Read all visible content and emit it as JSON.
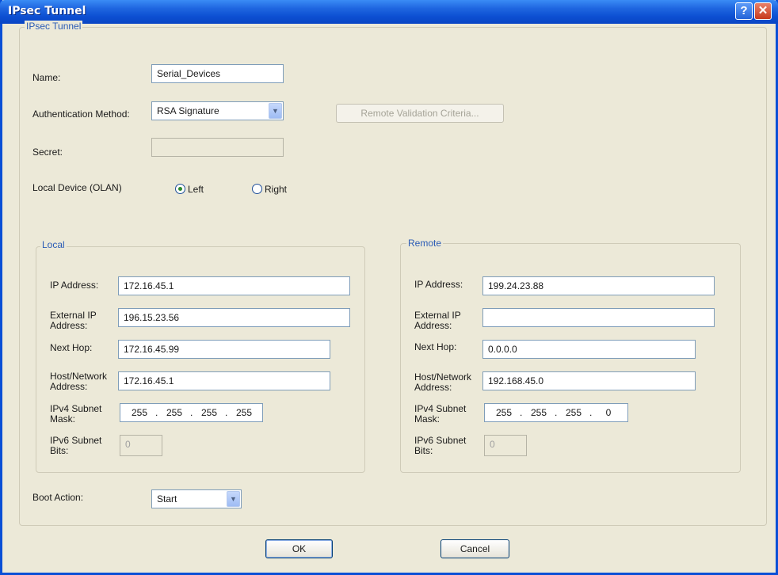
{
  "window": {
    "title": "IPsec Tunnel",
    "help_label": "?",
    "close_label": "✕"
  },
  "tunnel": {
    "group_label": "IPsec Tunnel",
    "name_label": "Name:",
    "name_value": "Serial_Devices",
    "auth_label": "Authentication Method:",
    "auth_value": "RSA Signature",
    "remote_validation_label": "Remote Validation Criteria...",
    "secret_label": "Secret:",
    "secret_value": "",
    "local_device_label": "Local Device (OLAN)",
    "radio_left_label": "Left",
    "radio_right_label": "Right",
    "selected_side": "Left"
  },
  "local": {
    "group_label": "Local",
    "ip_label": "IP Address:",
    "ip_value": "172.16.45.1",
    "external_ip_label_1": "External IP",
    "external_ip_label_2": "Address:",
    "external_ip_value": "196.15.23.56",
    "next_hop_label": "Next Hop:",
    "next_hop_value": "172.16.45.99",
    "host_network_label_1": "Host/Network",
    "host_network_label_2": "Address:",
    "host_network_value": "172.16.45.1",
    "ipv4_mask_label_1": "IPv4 Subnet",
    "ipv4_mask_label_2": "Mask:",
    "mask": [
      "255",
      "255",
      "255",
      "255"
    ],
    "ipv6_bits_label_1": "IPv6 Subnet",
    "ipv6_bits_label_2": "Bits:",
    "ipv6_bits_value": "0"
  },
  "remote": {
    "group_label": "Remote",
    "ip_label": "IP Address:",
    "ip_value": "199.24.23.88",
    "external_ip_label_1": "External IP",
    "external_ip_label_2": "Address:",
    "external_ip_value": "",
    "next_hop_label": "Next Hop:",
    "next_hop_value": "0.0.0.0",
    "host_network_label_1": "Host/Network",
    "host_network_label_2": "Address:",
    "host_network_value": "192.168.45.0",
    "ipv4_mask_label_1": "IPv4 Subnet",
    "ipv4_mask_label_2": "Mask:",
    "mask": [
      "255",
      "255",
      "255",
      "0"
    ],
    "ipv6_bits_label_1": "IPv6 Subnet",
    "ipv6_bits_label_2": "Bits:",
    "ipv6_bits_value": "0"
  },
  "boot": {
    "label": "Boot Action:",
    "value": "Start"
  },
  "buttons": {
    "ok": "OK",
    "cancel": "Cancel"
  },
  "mask_separator": "."
}
